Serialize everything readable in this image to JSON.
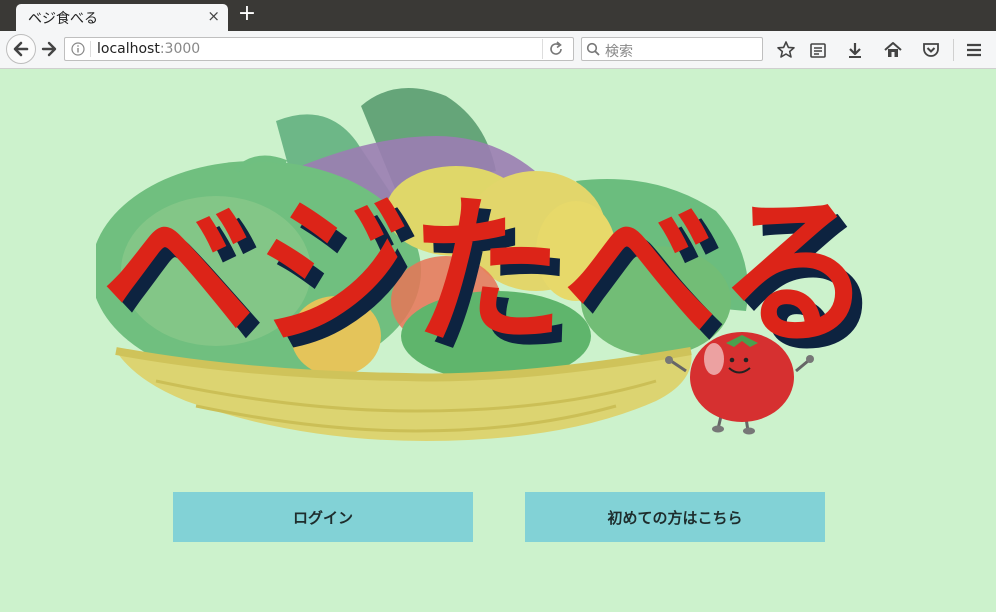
{
  "browser": {
    "tab_title": "ベジ食べる",
    "tab_close": "×",
    "new_tab": "+",
    "url_host": "localhost",
    "url_port": ":3000",
    "search_placeholder": "検索"
  },
  "hero": {
    "logo_text": "ベジたべる"
  },
  "actions": {
    "login_label": "ログイン",
    "signup_label": "初めての方はこちら"
  },
  "colors": {
    "page_bg": "#ccf2cc",
    "button_bg": "#82d2d6",
    "logo_red": "#dc2418",
    "logo_shadow": "#0d2340"
  }
}
